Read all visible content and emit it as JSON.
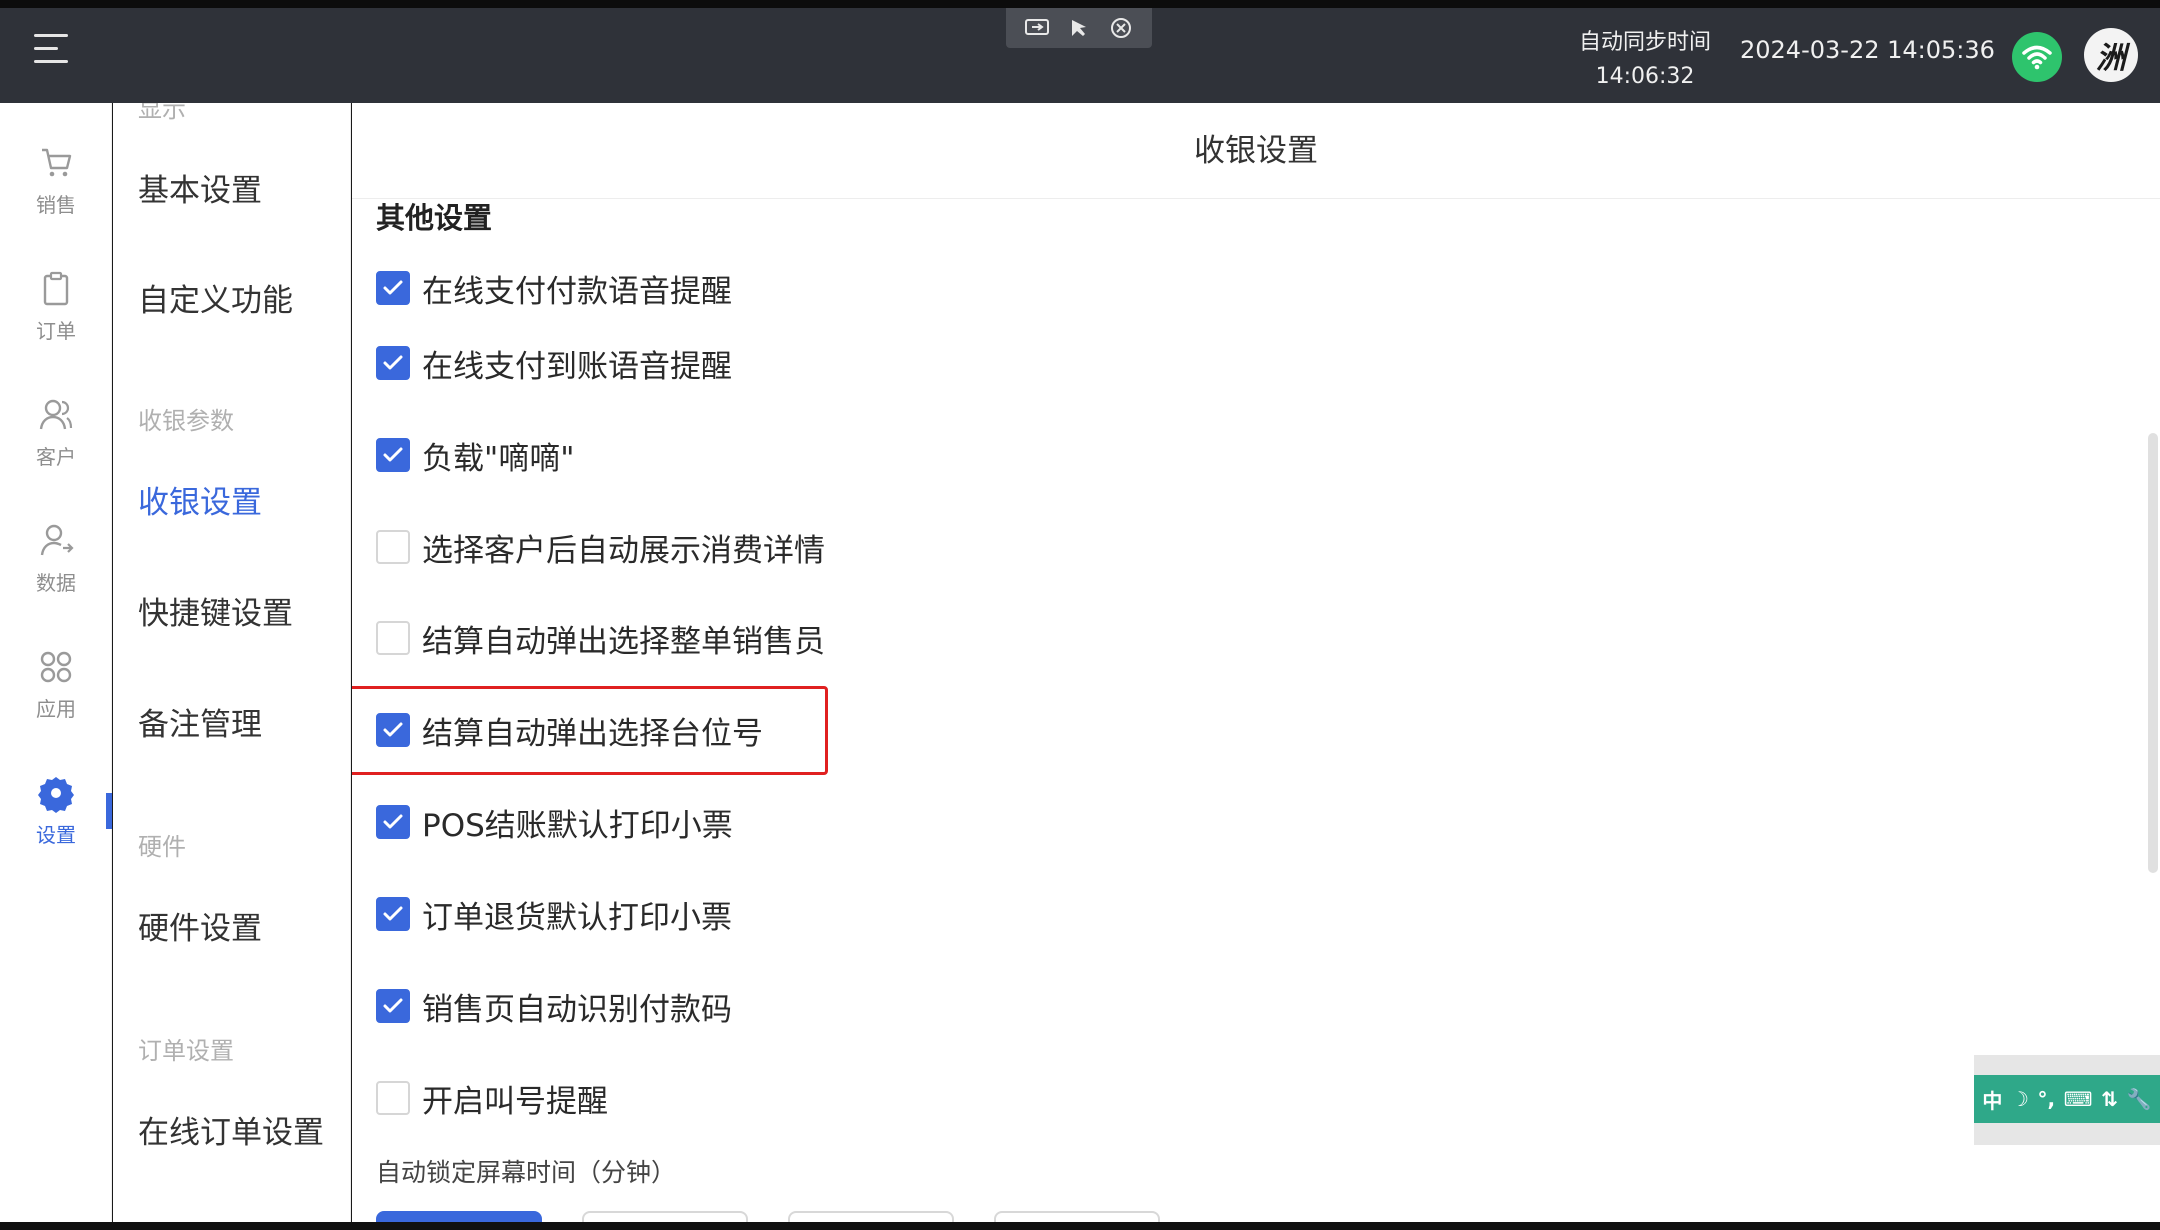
{
  "topbar": {
    "sync_label": "自动同步时间",
    "sync_time": "14:06:32",
    "datetime": "2024-03-22 14:05:36",
    "avatar_text": "洲",
    "wifi_color": "#2ec46d"
  },
  "iconnav": {
    "items": [
      {
        "label": "销售",
        "icon": "cart-icon"
      },
      {
        "label": "订单",
        "icon": "clipboard-icon"
      },
      {
        "label": "客户",
        "icon": "users-icon"
      },
      {
        "label": "数据",
        "icon": "user-data-icon"
      },
      {
        "label": "应用",
        "icon": "apps-icon"
      },
      {
        "label": "设置",
        "icon": "gear-icon",
        "active": true
      }
    ]
  },
  "sidebar": {
    "partial_top": "显示",
    "basic": "基本设置",
    "custom": "自定义功能",
    "cashier_params": "收银参数",
    "cashier_settings": "收银设置",
    "shortcut": "快捷键设置",
    "notes": "备注管理",
    "hardware_section": "硬件",
    "hardware_settings": "硬件设置",
    "order_section": "订单设置",
    "online_order": "在线订单设置"
  },
  "main": {
    "title": "收银设置",
    "section_title": "其他设置",
    "options": [
      {
        "label": "在线支付付款语音提醒",
        "checked": true
      },
      {
        "label": "在线支付到账语音提醒",
        "checked": true
      },
      {
        "label": "负载\"嘀嘀\"",
        "checked": true
      },
      {
        "label": "选择客户后自动展示消费详情",
        "checked": false
      },
      {
        "label": "结算自动弹出选择整单销售员",
        "checked": false
      },
      {
        "label": "结算自动弹出选择台位号",
        "checked": true
      },
      {
        "label": "POS结账默认打印小票",
        "checked": true
      },
      {
        "label": "订单退货默认打印小票",
        "checked": true
      },
      {
        "label": "销售页自动识别付款码",
        "checked": true
      },
      {
        "label": "开启叫号提醒",
        "checked": false
      }
    ],
    "lock_label": "自动锁定屏幕时间（分钟）"
  },
  "ime": {
    "mode": "中",
    "items": [
      "中",
      "☽",
      "°,",
      "⌨",
      "⇅",
      "🔧"
    ]
  },
  "accent_color": "#3a68dc",
  "highlight_color": "#e02020"
}
